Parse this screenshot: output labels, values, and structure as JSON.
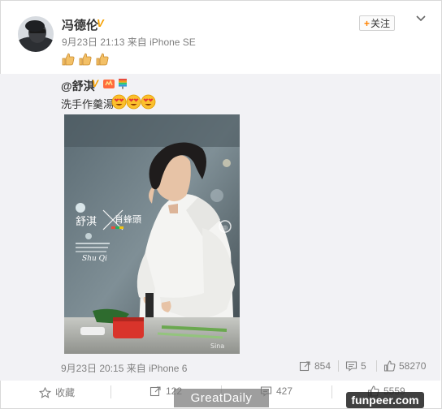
{
  "post": {
    "username": "冯德伦",
    "verified_mark": "V",
    "date": "9月23日 21:13",
    "source_prefix": "来自",
    "source": "iPhone SE",
    "follow_label": "关注",
    "follow_plus": "+",
    "thumb_count": 3
  },
  "repost": {
    "username": "@舒淇",
    "verified_mark": "V",
    "text": "洗手作羹湯",
    "emoji_count": 3,
    "photo": {
      "name_left": "舒淇",
      "name_right": "肖蜂頭",
      "name_latin": "Shu Qi"
    },
    "date": "9月23日 20:15",
    "source_prefix": "来自",
    "source": "iPhone 6",
    "reposts": "854",
    "comments": "5",
    "likes": "58270"
  },
  "actions": {
    "favorite_label": "收藏",
    "repost_count": "122",
    "comment_count": "427",
    "like_count": "5559"
  },
  "watermarks": {
    "left": "GreatDaily",
    "right": "funpeer.com"
  },
  "colors": {
    "accent_orange": "#ff8200",
    "verified_gold": "#f6a000",
    "repost_bg": "#f2f2f5",
    "meta_gray": "#808080"
  }
}
